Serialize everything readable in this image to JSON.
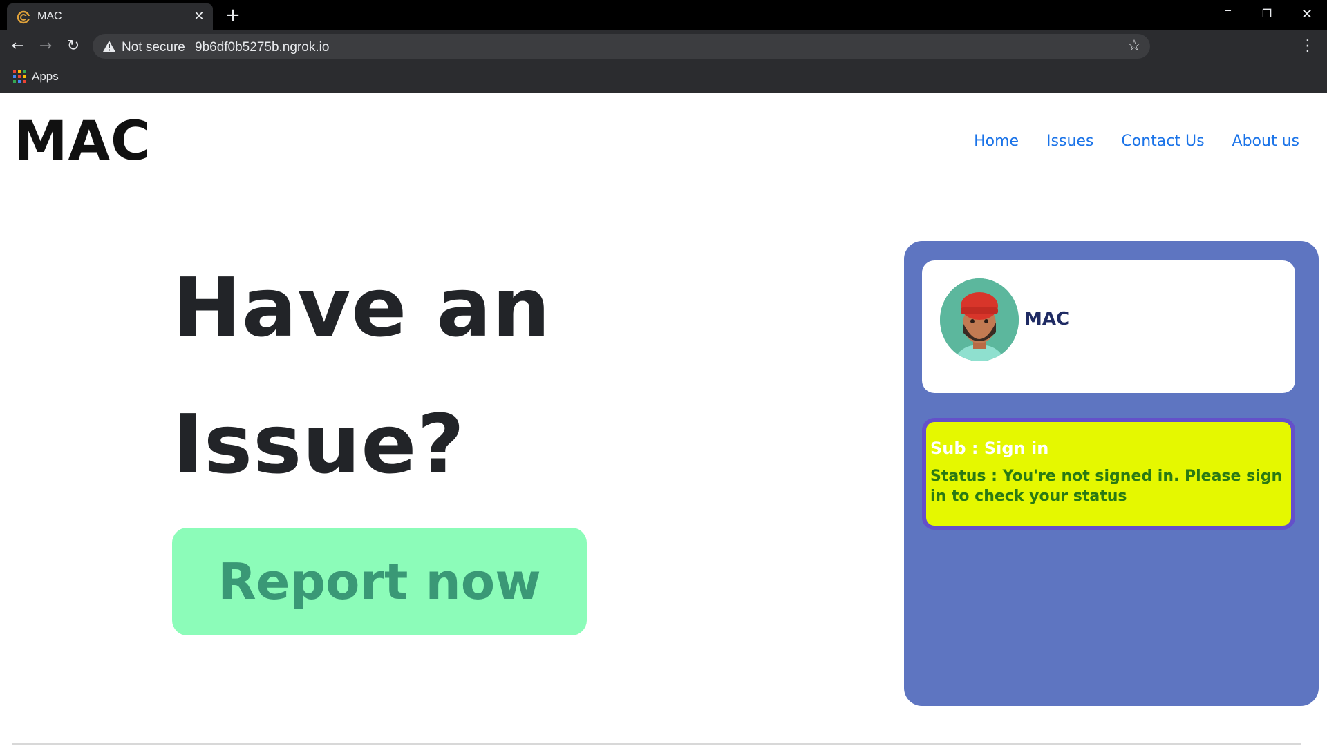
{
  "browser": {
    "tab_title": "MAC",
    "tab_close": "✕",
    "new_tab": "+",
    "security_label": "Not secure",
    "url": "9b6df0b5275b.ngrok.io",
    "bookmarks": [
      {
        "label": "Apps"
      }
    ],
    "colors": {
      "chrome_bg": "#2b2c2f",
      "tabstrip_bg": "#000000",
      "text": "#e8eaed"
    }
  },
  "header": {
    "logo": "MAC",
    "nav": [
      {
        "label": "Home"
      },
      {
        "label": "Issues"
      },
      {
        "label": "Contact Us"
      },
      {
        "label": "About us"
      }
    ]
  },
  "hero": {
    "line1": "Have an",
    "line2": "Issue?",
    "cta_label": "Report now"
  },
  "panel": {
    "profile_name": "MAC",
    "avatar_icon": "user-avatar-icon",
    "subject": "Sub : Sign in",
    "status": "Status : You're not signed in. Please sign in to check your status"
  },
  "colors": {
    "accent_link": "#1a73e8",
    "cta_bg": "#8cfcb9",
    "cta_text": "#3a9876",
    "panel_bg": "#5e75c1",
    "status_bg": "#e5f800",
    "status_border": "#6450c9",
    "status_text": "#2a7a13"
  }
}
